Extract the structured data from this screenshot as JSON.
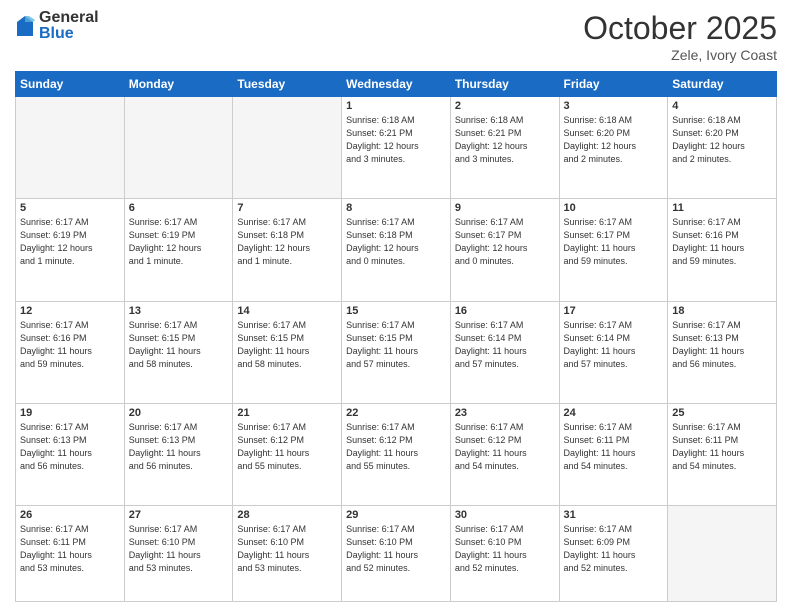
{
  "logo": {
    "general": "General",
    "blue": "Blue"
  },
  "title": "October 2025",
  "subtitle": "Zele, Ivory Coast",
  "days_header": [
    "Sunday",
    "Monday",
    "Tuesday",
    "Wednesday",
    "Thursday",
    "Friday",
    "Saturday"
  ],
  "weeks": [
    [
      {
        "num": "",
        "info": ""
      },
      {
        "num": "",
        "info": ""
      },
      {
        "num": "",
        "info": ""
      },
      {
        "num": "1",
        "info": "Sunrise: 6:18 AM\nSunset: 6:21 PM\nDaylight: 12 hours\nand 3 minutes."
      },
      {
        "num": "2",
        "info": "Sunrise: 6:18 AM\nSunset: 6:21 PM\nDaylight: 12 hours\nand 3 minutes."
      },
      {
        "num": "3",
        "info": "Sunrise: 6:18 AM\nSunset: 6:20 PM\nDaylight: 12 hours\nand 2 minutes."
      },
      {
        "num": "4",
        "info": "Sunrise: 6:18 AM\nSunset: 6:20 PM\nDaylight: 12 hours\nand 2 minutes."
      }
    ],
    [
      {
        "num": "5",
        "info": "Sunrise: 6:17 AM\nSunset: 6:19 PM\nDaylight: 12 hours\nand 1 minute."
      },
      {
        "num": "6",
        "info": "Sunrise: 6:17 AM\nSunset: 6:19 PM\nDaylight: 12 hours\nand 1 minute."
      },
      {
        "num": "7",
        "info": "Sunrise: 6:17 AM\nSunset: 6:18 PM\nDaylight: 12 hours\nand 1 minute."
      },
      {
        "num": "8",
        "info": "Sunrise: 6:17 AM\nSunset: 6:18 PM\nDaylight: 12 hours\nand 0 minutes."
      },
      {
        "num": "9",
        "info": "Sunrise: 6:17 AM\nSunset: 6:17 PM\nDaylight: 12 hours\nand 0 minutes."
      },
      {
        "num": "10",
        "info": "Sunrise: 6:17 AM\nSunset: 6:17 PM\nDaylight: 11 hours\nand 59 minutes."
      },
      {
        "num": "11",
        "info": "Sunrise: 6:17 AM\nSunset: 6:16 PM\nDaylight: 11 hours\nand 59 minutes."
      }
    ],
    [
      {
        "num": "12",
        "info": "Sunrise: 6:17 AM\nSunset: 6:16 PM\nDaylight: 11 hours\nand 59 minutes."
      },
      {
        "num": "13",
        "info": "Sunrise: 6:17 AM\nSunset: 6:15 PM\nDaylight: 11 hours\nand 58 minutes."
      },
      {
        "num": "14",
        "info": "Sunrise: 6:17 AM\nSunset: 6:15 PM\nDaylight: 11 hours\nand 58 minutes."
      },
      {
        "num": "15",
        "info": "Sunrise: 6:17 AM\nSunset: 6:15 PM\nDaylight: 11 hours\nand 57 minutes."
      },
      {
        "num": "16",
        "info": "Sunrise: 6:17 AM\nSunset: 6:14 PM\nDaylight: 11 hours\nand 57 minutes."
      },
      {
        "num": "17",
        "info": "Sunrise: 6:17 AM\nSunset: 6:14 PM\nDaylight: 11 hours\nand 57 minutes."
      },
      {
        "num": "18",
        "info": "Sunrise: 6:17 AM\nSunset: 6:13 PM\nDaylight: 11 hours\nand 56 minutes."
      }
    ],
    [
      {
        "num": "19",
        "info": "Sunrise: 6:17 AM\nSunset: 6:13 PM\nDaylight: 11 hours\nand 56 minutes."
      },
      {
        "num": "20",
        "info": "Sunrise: 6:17 AM\nSunset: 6:13 PM\nDaylight: 11 hours\nand 56 minutes."
      },
      {
        "num": "21",
        "info": "Sunrise: 6:17 AM\nSunset: 6:12 PM\nDaylight: 11 hours\nand 55 minutes."
      },
      {
        "num": "22",
        "info": "Sunrise: 6:17 AM\nSunset: 6:12 PM\nDaylight: 11 hours\nand 55 minutes."
      },
      {
        "num": "23",
        "info": "Sunrise: 6:17 AM\nSunset: 6:12 PM\nDaylight: 11 hours\nand 54 minutes."
      },
      {
        "num": "24",
        "info": "Sunrise: 6:17 AM\nSunset: 6:11 PM\nDaylight: 11 hours\nand 54 minutes."
      },
      {
        "num": "25",
        "info": "Sunrise: 6:17 AM\nSunset: 6:11 PM\nDaylight: 11 hours\nand 54 minutes."
      }
    ],
    [
      {
        "num": "26",
        "info": "Sunrise: 6:17 AM\nSunset: 6:11 PM\nDaylight: 11 hours\nand 53 minutes."
      },
      {
        "num": "27",
        "info": "Sunrise: 6:17 AM\nSunset: 6:10 PM\nDaylight: 11 hours\nand 53 minutes."
      },
      {
        "num": "28",
        "info": "Sunrise: 6:17 AM\nSunset: 6:10 PM\nDaylight: 11 hours\nand 53 minutes."
      },
      {
        "num": "29",
        "info": "Sunrise: 6:17 AM\nSunset: 6:10 PM\nDaylight: 11 hours\nand 52 minutes."
      },
      {
        "num": "30",
        "info": "Sunrise: 6:17 AM\nSunset: 6:10 PM\nDaylight: 11 hours\nand 52 minutes."
      },
      {
        "num": "31",
        "info": "Sunrise: 6:17 AM\nSunset: 6:09 PM\nDaylight: 11 hours\nand 52 minutes."
      },
      {
        "num": "",
        "info": ""
      }
    ]
  ]
}
